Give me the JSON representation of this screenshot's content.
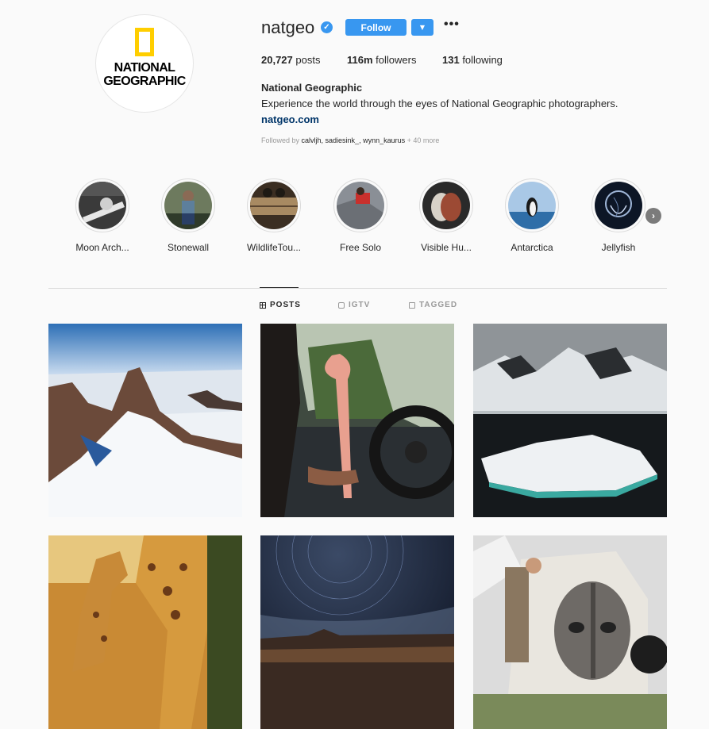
{
  "profile": {
    "username": "natgeo",
    "follow_label": "Follow",
    "dropdown_glyph": "▼",
    "more_glyph": "•••",
    "verified_glyph": "✓",
    "logo_text_line1": "NATIONAL",
    "logo_text_line2": "GEOGRAPHIC",
    "full_name": "National Geographic",
    "bio": "Experience the world through the eyes of National Geographic photographers.",
    "website": "natgeo.com"
  },
  "stats": {
    "posts_count": "20,727",
    "posts_label": " posts",
    "followers_count": "116m",
    "followers_label": " followers",
    "following_count": "131",
    "following_label": " following"
  },
  "followed_by": {
    "prefix": "Followed by ",
    "users": "calvljh, sadiesink_, wynn_kaurus",
    "suffix": " + 40 more"
  },
  "highlights": [
    {
      "label": "Moon Arch..."
    },
    {
      "label": "Stonewall"
    },
    {
      "label": "WildlifeTou..."
    },
    {
      "label": "Free Solo"
    },
    {
      "label": "Visible Hu..."
    },
    {
      "label": "Antarctica"
    },
    {
      "label": "Jellyfish"
    }
  ],
  "highlights_next_glyph": "›",
  "tabs": [
    {
      "label": "POSTS",
      "icon": "grid-icon",
      "active": true
    },
    {
      "label": "IGTV",
      "icon": "tv-icon",
      "active": false
    },
    {
      "label": "TAGGED",
      "icon": "tag-icon",
      "active": false
    }
  ],
  "posts": [
    {
      "subject": "snowy mountain peak"
    },
    {
      "subject": "flamingo in car"
    },
    {
      "subject": "antarctic ice floe"
    },
    {
      "subject": "giraffes at sunset"
    },
    {
      "subject": "star trails night sky"
    },
    {
      "subject": "viking helmet tent"
    }
  ],
  "colors": {
    "accent": "#3897f0",
    "link": "#003569",
    "logo_yellow": "#ffce00"
  }
}
